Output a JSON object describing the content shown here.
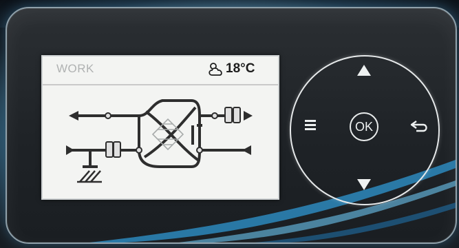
{
  "display": {
    "mode": "WORK",
    "outdoor_temperature": "18°C",
    "weather_icon": "partly-cloudy-icon",
    "schematic_icon": "heat-recovery-ventilation-diagram"
  },
  "controls": {
    "ok_label": "OK",
    "up_icon": "arrow-up-icon",
    "down_icon": "arrow-down-icon",
    "menu_icon": "menu-icon",
    "back_icon": "back-icon"
  },
  "colors": {
    "screen_background": "#f3f4f2",
    "panel_background": "#22262a",
    "accent": "#3aa8e0",
    "control_glyphs": "#eef1f1"
  }
}
